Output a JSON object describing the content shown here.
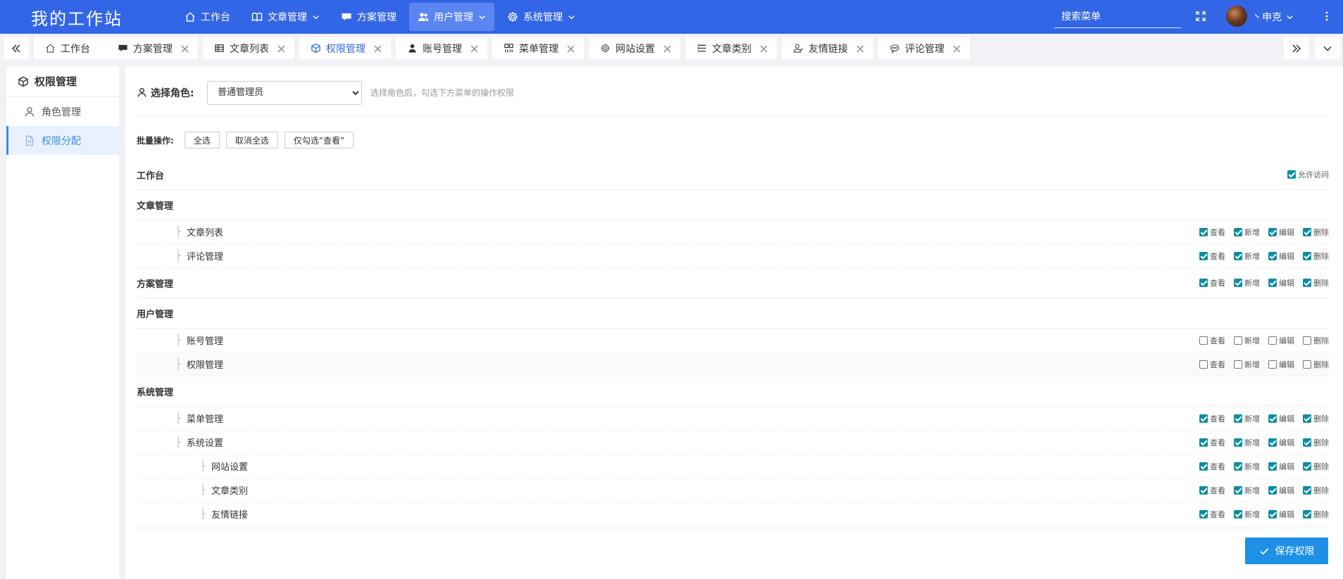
{
  "brand": "我的工作站",
  "nav": [
    {
      "label": "工作台",
      "icon": "home-icon"
    },
    {
      "label": "文章管理",
      "icon": "book-icon",
      "dropdown": true
    },
    {
      "label": "方案管理",
      "icon": "chat-icon"
    },
    {
      "label": "用户管理",
      "icon": "users-icon",
      "dropdown": true,
      "active": true
    },
    {
      "label": "系统管理",
      "icon": "gear-icon",
      "dropdown": true
    }
  ],
  "search_placeholder": "搜索菜单",
  "username": "丶申克",
  "tabs": [
    {
      "label": "工作台",
      "icon": "home-icon",
      "closable": false
    },
    {
      "label": "方案管理",
      "icon": "chat-icon",
      "closable": true
    },
    {
      "label": "文章列表",
      "icon": "table-icon",
      "closable": true
    },
    {
      "label": "权限管理",
      "icon": "cube-icon",
      "closable": true,
      "active": true
    },
    {
      "label": "账号管理",
      "icon": "user-icon",
      "closable": true
    },
    {
      "label": "菜单管理",
      "icon": "menu-grid-icon",
      "closable": true
    },
    {
      "label": "网站设置",
      "icon": "gear-icon",
      "closable": true
    },
    {
      "label": "文章类别",
      "icon": "list-icon",
      "closable": true
    },
    {
      "label": "友情链接",
      "icon": "friends-icon",
      "closable": true
    },
    {
      "label": "评论管理",
      "icon": "comment-icon",
      "closable": true
    }
  ],
  "sidebar": {
    "title": "权限管理",
    "items": [
      {
        "label": "角色管理",
        "icon": "user-icon",
        "active": false
      },
      {
        "label": "权限分配",
        "icon": "doc-icon",
        "active": true
      }
    ]
  },
  "role": {
    "label": "选择角色:",
    "selected": "普通管理员",
    "hint": "选择角色后，勾选下方菜单的操作权限"
  },
  "batch": {
    "label": "批量操作:",
    "buttons": [
      "全选",
      "取消全选",
      "仅勾选“查看”"
    ]
  },
  "perm_labels": [
    "查看",
    "新增",
    "编辑",
    "删除"
  ],
  "allow_access_label": "允许访问",
  "rows": [
    {
      "type": "group",
      "name": "工作台",
      "allow": true
    },
    {
      "type": "group",
      "name": "文章管理"
    },
    {
      "type": "child",
      "level": 1,
      "name": "文章列表",
      "perms": [
        true,
        true,
        true,
        true
      ]
    },
    {
      "type": "child",
      "level": 1,
      "name": "评论管理",
      "perms": [
        true,
        true,
        true,
        true
      ]
    },
    {
      "type": "group",
      "name": "方案管理",
      "perms": [
        true,
        true,
        true,
        true
      ]
    },
    {
      "type": "group",
      "name": "用户管理"
    },
    {
      "type": "child",
      "level": 1,
      "name": "账号管理",
      "perms": [
        false,
        false,
        false,
        false
      ]
    },
    {
      "type": "child",
      "level": 1,
      "name": "权限管理",
      "perms": [
        false,
        false,
        false,
        false
      ],
      "highlight": true
    },
    {
      "type": "group",
      "name": "系统管理"
    },
    {
      "type": "child",
      "level": 1,
      "name": "菜单管理",
      "perms": [
        true,
        true,
        true,
        true
      ]
    },
    {
      "type": "child",
      "level": 1,
      "name": "系统设置",
      "perms": [
        true,
        true,
        true,
        true
      ]
    },
    {
      "type": "child",
      "level": 2,
      "name": "网站设置",
      "perms": [
        true,
        true,
        true,
        true
      ]
    },
    {
      "type": "child",
      "level": 2,
      "name": "文章类别",
      "perms": [
        true,
        true,
        true,
        true
      ]
    },
    {
      "type": "child",
      "level": 2,
      "name": "友情链接",
      "perms": [
        true,
        true,
        true,
        true
      ]
    }
  ],
  "save_label": "保存权限"
}
